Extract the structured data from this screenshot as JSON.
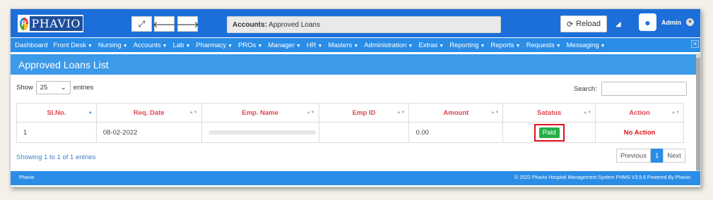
{
  "app": {
    "logo_mark": "P",
    "logo_text": "PHAVIO"
  },
  "toolbar": {
    "expand_icon": "expand-icon",
    "back_icon": "arrow-left-icon",
    "forward_icon": "arrow-right-icon",
    "reload_label": "Reload"
  },
  "breadcrumb": {
    "section": "Accounts:",
    "page": "Approved Loans"
  },
  "user": {
    "name": "Admin"
  },
  "menu": [
    {
      "label": "Dashboard",
      "dropdown": false
    },
    {
      "label": "Front Desk",
      "dropdown": true
    },
    {
      "label": "Nursing",
      "dropdown": true
    },
    {
      "label": "Accounts",
      "dropdown": true
    },
    {
      "label": "Lab",
      "dropdown": true
    },
    {
      "label": "Pharmacy",
      "dropdown": true
    },
    {
      "label": "PROs",
      "dropdown": true
    },
    {
      "label": "Manager",
      "dropdown": true
    },
    {
      "label": "HR",
      "dropdown": true
    },
    {
      "label": "Masters",
      "dropdown": true
    },
    {
      "label": "Administration",
      "dropdown": true
    },
    {
      "label": "Extras",
      "dropdown": true
    },
    {
      "label": "Reporting",
      "dropdown": true
    },
    {
      "label": "Reports",
      "dropdown": true
    },
    {
      "label": "Requests",
      "dropdown": true
    },
    {
      "label": "Messaging",
      "dropdown": true
    }
  ],
  "panel": {
    "title": "Approved Loans List"
  },
  "list_controls": {
    "show_label": "Show",
    "entries_value": "25",
    "entries_label": "entries",
    "search_label": "Search:"
  },
  "table": {
    "headers": [
      "Sl.No.",
      "Req. Date",
      "Emp. Name",
      "Emp ID",
      "Amount",
      "Satatus",
      "Action"
    ],
    "rows": [
      {
        "sl": "1",
        "date": "08-02-2022",
        "name": "",
        "emp_id": "",
        "amount": "0.00",
        "status": "Paid",
        "action": "No Action"
      }
    ]
  },
  "summary": "Showing 1 to 1 of 1 entries",
  "pagination": {
    "previous": "Previous",
    "current": "1",
    "next": "Next"
  },
  "footer": {
    "left": "Phavio",
    "right": "© 2022 Phavio Hospital Management System PHMS V3.5.6 Powered By Phavio"
  },
  "colors": {
    "topbar": "#1c6fd8",
    "menubar": "#2a8de6",
    "header_text": "#e0454f",
    "status_paid": "#27ae48",
    "highlight": "#e0101a"
  }
}
